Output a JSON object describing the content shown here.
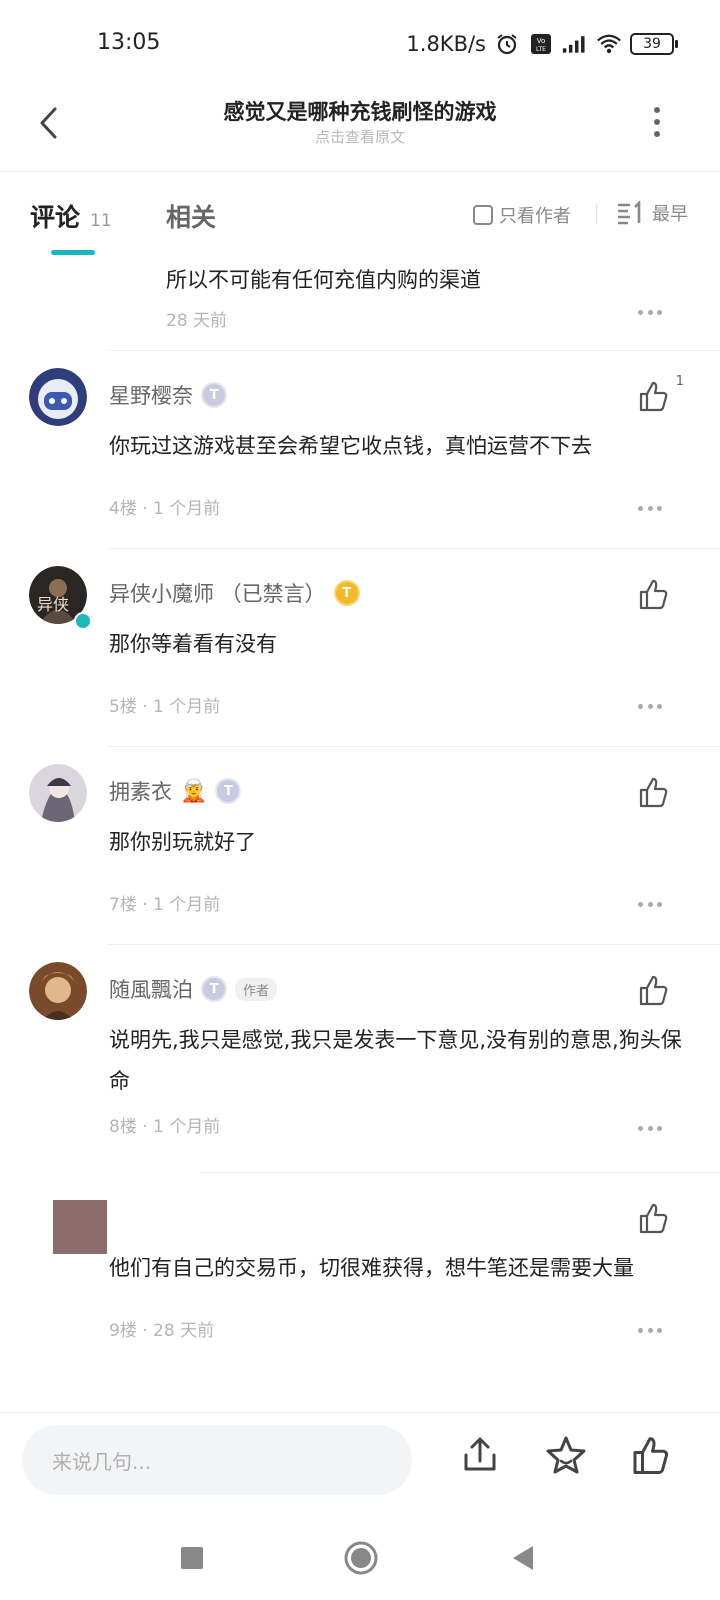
{
  "status_bar": {
    "time": "13:05",
    "speed": "1.8KB/s",
    "battery": "39",
    "icons": [
      "alarm-icon",
      "volte-icon",
      "signal-icon",
      "wifi-icon",
      "battery-icon"
    ]
  },
  "header": {
    "title": "感觉又是哪种充钱刷怪的游戏",
    "subtitle": "点击查看原文"
  },
  "tabs": {
    "comments_label": "评论",
    "comments_count": "11",
    "related_label": "相关",
    "author_only_label": "只看作者",
    "sort_label": "最早"
  },
  "reply_snippet": {
    "text": "所以不可能有任何充值内购的渠道",
    "meta": "28 天前"
  },
  "comments": [
    {
      "username": "星野樱奈",
      "badge": "T",
      "text": "你玩过这游戏甚至会希望它收点钱，真怕运营不下去",
      "meta": "4楼 · 1 个月前",
      "likes": "1"
    },
    {
      "username": "异侠小魔师 （已禁言）",
      "badge": "T",
      "text": "那你等着看有没有",
      "meta": "5楼 · 1 个月前",
      "avatar_text": "异侠"
    },
    {
      "username": "拥素衣",
      "badge": "T",
      "text": "那你别玩就好了",
      "meta": "7楼 · 1 个月前"
    },
    {
      "username": "随風飄泊",
      "badge": "T",
      "author_tag": "作者",
      "text": "说明先,我只是感觉,我只是发表一下意见,没有别的意思,狗头保命",
      "meta": "8楼 · 1 个月前"
    },
    {
      "username": "",
      "text": "他们有自己的交易币，切很难获得，想牛笔还是需要大量",
      "meta": "9楼 · 28 天前"
    }
  ],
  "bottom_bar": {
    "input_placeholder": "来说几句...",
    "icons": [
      "share-icon",
      "star-icon",
      "like-icon"
    ]
  },
  "nav_bar": {
    "icons": [
      "recents-square-icon",
      "home-circle-icon",
      "back-triangle-icon"
    ]
  }
}
